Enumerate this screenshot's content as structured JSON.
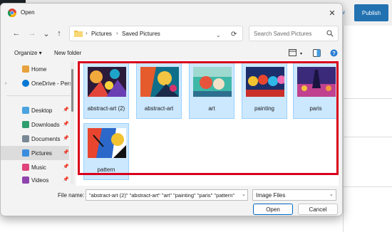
{
  "background_app": {
    "top_link": "w",
    "publish_label": "Publish"
  },
  "dialog": {
    "title": "Open",
    "close_glyph": "✕"
  },
  "navigation": {
    "back_glyph": "←",
    "forward_glyph": "→",
    "recent_glyph": "⌄",
    "up_glyph": "↑",
    "breadcrumbs": [
      "Pictures",
      "Saved Pictures"
    ],
    "crumb_separator": "›",
    "refresh_glyph": "⟳"
  },
  "search": {
    "placeholder": "Search Saved Pictures"
  },
  "toolbar": {
    "organize_label": "Organize ▾",
    "new_folder_label": "New folder"
  },
  "sidebar": {
    "items": [
      {
        "label": "Home",
        "icon": "home-icon",
        "color": "#e6a23c",
        "pinned": false
      },
      {
        "label": "OneDrive - Perso",
        "icon": "cloud-icon",
        "color": "#0078d4",
        "pinned": false
      },
      {
        "label": "Desktop",
        "icon": "desktop-icon",
        "color": "#4aa3df",
        "pinned": true
      },
      {
        "label": "Downloads",
        "icon": "download-icon",
        "color": "#2f9e6e",
        "pinned": true
      },
      {
        "label": "Documents",
        "icon": "document-icon",
        "color": "#7a8896",
        "pinned": true
      },
      {
        "label": "Pictures",
        "icon": "pictures-icon",
        "color": "#3a8dde",
        "pinned": true,
        "selected": true
      },
      {
        "label": "Music",
        "icon": "music-icon",
        "color": "#e0447c",
        "pinned": true
      },
      {
        "label": "Videos",
        "icon": "videos-icon",
        "color": "#8e44ad",
        "pinned": true
      }
    ]
  },
  "files": [
    {
      "name": "abstract-art (2)",
      "thumb": "abstract-art-2-thumbnail"
    },
    {
      "name": "abstract-art",
      "thumb": "abstract-art-thumbnail"
    },
    {
      "name": "art",
      "thumb": "art-thumbnail"
    },
    {
      "name": "painting",
      "thumb": "painting-thumbnail"
    },
    {
      "name": "paris",
      "thumb": "paris-thumbnail"
    },
    {
      "name": "pattern",
      "thumb": "pattern-thumbnail"
    }
  ],
  "bottom": {
    "file_name_label": "File name:",
    "file_name_value": "\"abstract-art (2)\" \"abstract-art\" \"art\" \"painting\" \"paris\" \"pattern\"",
    "file_type_value": "Image Files",
    "open_label": "Open",
    "cancel_label": "Cancel"
  },
  "colors": {
    "selection_fill": "#cce8ff",
    "highlight_box": "#d9001b",
    "publish_button": "#2271b1"
  }
}
